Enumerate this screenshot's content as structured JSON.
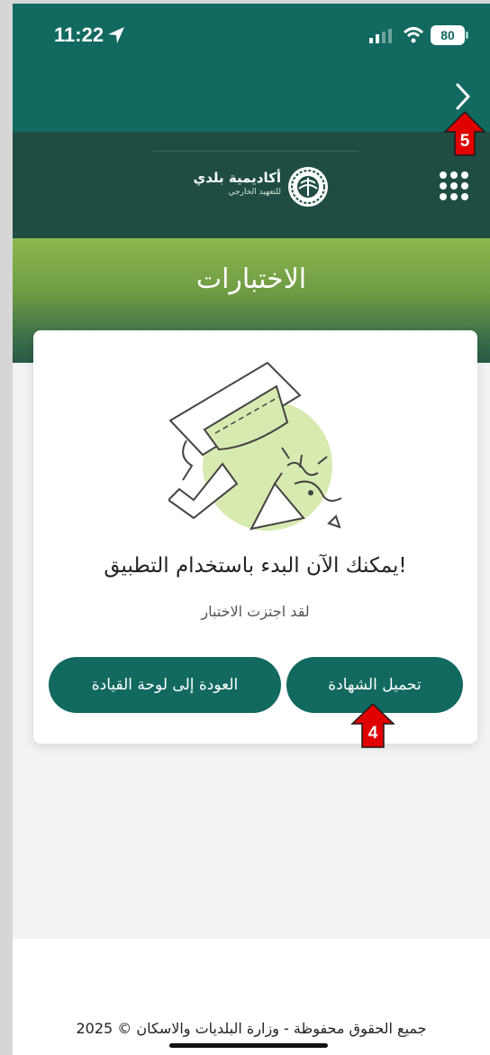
{
  "status_bar": {
    "time": "11:22",
    "battery": "80"
  },
  "header": {
    "logo_title": "أكاديمية بلدي",
    "logo_subtitle": "للتعهيد الخارجي"
  },
  "page": {
    "title": "الاختبارات"
  },
  "card": {
    "heading": "يمكنك الآن البدء باستخدام التطبيق!",
    "subtext": "لقد اجتزت الاختبار",
    "download_button": "تحميل الشهادة",
    "dashboard_button": "العودة إلى لوحة القيادة"
  },
  "annotations": {
    "back_marker": "5",
    "download_marker": "4"
  },
  "footer": {
    "text": "جميع الحقوق محفوظة - وزارة البلديات والاسكان © 2025"
  },
  "colors": {
    "primary": "#12695f",
    "header_dark": "#1f4d44",
    "green_light": "#8db84e",
    "annotation_red": "#e00000"
  }
}
